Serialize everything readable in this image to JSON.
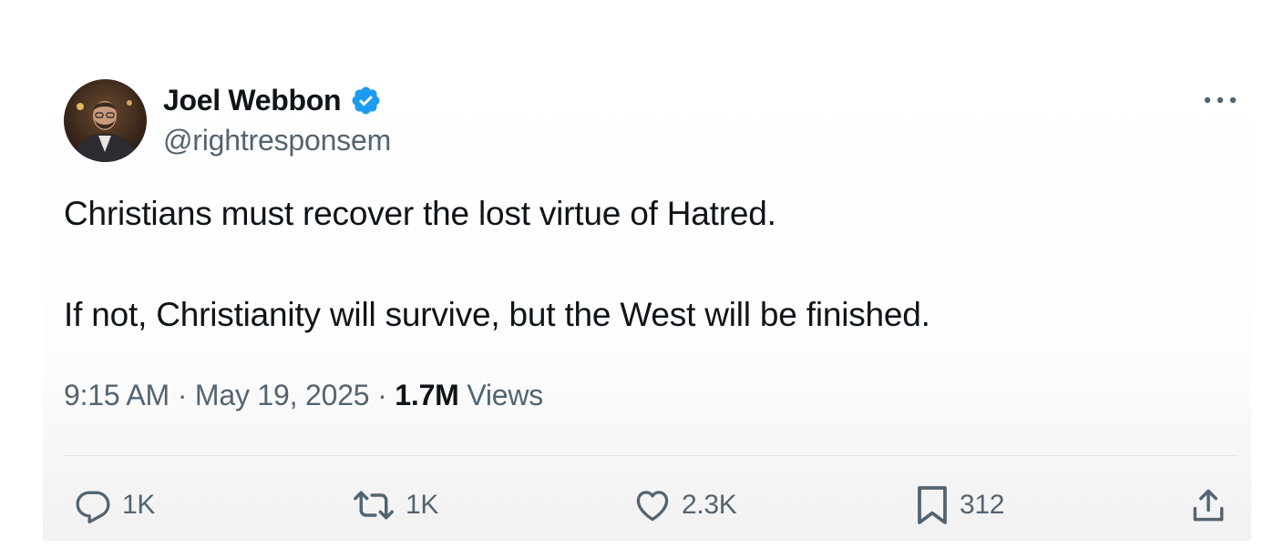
{
  "author": {
    "name": "Joel Webbon",
    "handle": "@rightresponsem",
    "verified": true,
    "verified_color": "#1d9bf0",
    "avatar_icon": "avatar-photo"
  },
  "tweet": {
    "lines": [
      "Christians must recover the lost virtue of Hatred.",
      "If not, Christianity will survive, but the West will be finished."
    ]
  },
  "meta": {
    "time": "9:15 AM",
    "separator": "·",
    "date": "May 19, 2025",
    "views_count": "1.7M",
    "views_label": "Views"
  },
  "actions": {
    "reply": {
      "icon": "reply-icon",
      "count": "1K"
    },
    "retweet": {
      "icon": "retweet-icon",
      "count": "1K"
    },
    "like": {
      "icon": "heart-icon",
      "count": "2.3K"
    },
    "bookmark": {
      "icon": "bookmark-icon",
      "count": "312"
    },
    "share": {
      "icon": "share-icon"
    }
  },
  "colors": {
    "text_primary": "#0f1419",
    "text_secondary": "#536471",
    "divider": "#e3e6e8"
  }
}
